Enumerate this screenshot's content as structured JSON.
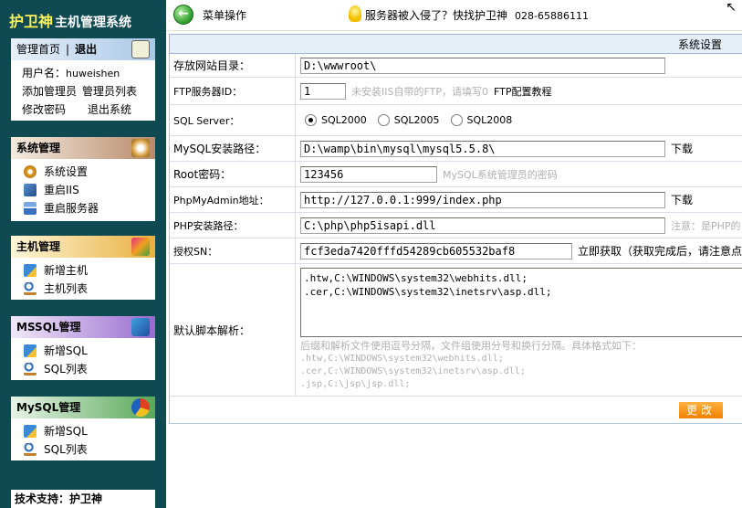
{
  "brand": {
    "name": "护卫神",
    "subtitle": "主机管理系统"
  },
  "user_panel": {
    "home": "管理首页",
    "logout": "退出",
    "username_label": "用户名：",
    "username": "huweishen",
    "links": [
      "添加管理员",
      "管理员列表",
      "修改密码",
      "退出系统"
    ]
  },
  "sys_panel": {
    "title": "系统管理",
    "items": [
      "系统设置",
      "重启IIS",
      "重启服务器"
    ]
  },
  "host_panel": {
    "title": "主机管理",
    "items": [
      "新增主机",
      "主机列表"
    ]
  },
  "mssql_panel": {
    "title": "MSSQL管理",
    "items": [
      "新增SQL",
      "SQL列表"
    ]
  },
  "mysql_panel": {
    "title": "MySQL管理",
    "items": [
      "新增SQL",
      "SQL列表"
    ]
  },
  "support": "技术支持：护卫神",
  "topbar": {
    "menu_op": "菜单操作",
    "ad": "服务器被入侵了？快找护卫神",
    "phone": "028-65886111"
  },
  "settings": {
    "section_title": "系统设置",
    "site_dir": {
      "label": "存放网站目录：",
      "value": "D:\\wwwroot\\"
    },
    "ftp_id": {
      "label": "FTP服务器ID：",
      "value": "1",
      "hint": "未安装IIS自带的FTP，请填写0",
      "link": "FTP配置教程"
    },
    "sql_server": {
      "label": "SQL Server：",
      "options": [
        "SQL2000",
        "SQL2005",
        "SQL2008"
      ],
      "selected": "SQL2000"
    },
    "mysql_path": {
      "label": "MySQL安装路径：",
      "value": "D:\\wamp\\bin\\mysql\\mysql5.5.8\\",
      "link": "下载"
    },
    "root_pwd": {
      "label": "Root密码：",
      "value": "123456",
      "hint": "MySQL系统管理员的密码"
    },
    "phpmyadmin": {
      "label": "PhpMyAdmin地址：",
      "value": "http://127.0.0.1:999/index.php",
      "link": "下载"
    },
    "php_path": {
      "label": "PHP安装路径：",
      "value": "C:\\php\\php5isapi.dll",
      "hint": "注意：是PHP的"
    },
    "license": {
      "label": "授权SN：",
      "value": "fcf3eda7420fffd54289cb605532baf8",
      "link": "立即获取（获取完成后，请注意点"
    },
    "script": {
      "label": "默认脚本解析：",
      "value": ".htw,C:\\WINDOWS\\system32\\webhits.dll;\n.cer,C:\\WINDOWS\\system32\\inetsrv\\asp.dll;",
      "hint": "后缀和解析文件使用逗号分隔，文件组使用分号和换行分隔。具体格式如下：",
      "examples": [
        ".htw,C:\\WINDOWS\\system32\\webhits.dll;",
        ".cer,C:\\WINDOWS\\system32\\inetsrv\\asp.dll;",
        ".jsp,C:\\jsp\\jsp.dll;"
      ]
    },
    "submit": "更改"
  }
}
